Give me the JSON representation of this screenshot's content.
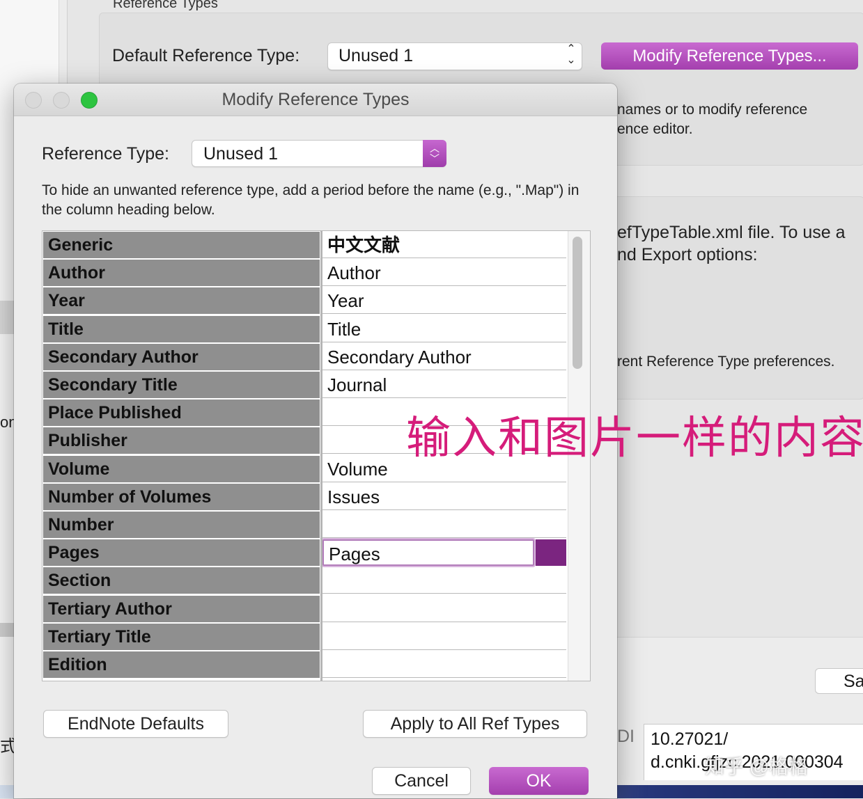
{
  "background": {
    "group_label": "Reference Types",
    "default_ref_type_label": "Default Reference Type:",
    "default_ref_type_value": "Unused 1",
    "modify_button": "Modify Reference Types...",
    "text1": "names or to modify reference",
    "text2": "ence editor.",
    "text3": "efTypeTable.xml file. To use a",
    "text4": "nd Export options:",
    "text5": "rent Reference Type preferences.",
    "left_fragment1": "on",
    "left_fragment2": "式及",
    "save_button": "Sa",
    "doi_label": "DI",
    "doi_value": "10.27021/\nd.cnki.gfjzc.2021.000304",
    "annotation": "输入和图片一样的内容",
    "watermark": "知乎 @格格"
  },
  "dialog": {
    "title": "Modify Reference Types",
    "ref_type_label": "Reference Type:",
    "ref_type_value": "Unused 1",
    "hint": "To hide an unwanted reference type, add a period before the name (e.g., \".Map\") in the column heading below.",
    "rows": [
      {
        "field": "Generic",
        "value": "中文文献"
      },
      {
        "field": "Author",
        "value": "Author"
      },
      {
        "field": "Year",
        "value": "Year"
      },
      {
        "field": "Title",
        "value": "Title"
      },
      {
        "field": "Secondary Author",
        "value": "Secondary Author"
      },
      {
        "field": "Secondary Title",
        "value": "Journal"
      },
      {
        "field": "Place Published",
        "value": ""
      },
      {
        "field": "Publisher",
        "value": ""
      },
      {
        "field": "Volume",
        "value": "Volume"
      },
      {
        "field": "Number of Volumes",
        "value": "Issues"
      },
      {
        "field": "Number",
        "value": ""
      },
      {
        "field": "Pages",
        "value": "Pages"
      },
      {
        "field": "Section",
        "value": ""
      },
      {
        "field": "Tertiary Author",
        "value": ""
      },
      {
        "field": "Tertiary Title",
        "value": ""
      },
      {
        "field": "Edition",
        "value": ""
      }
    ],
    "buttons": {
      "defaults": "EndNote Defaults",
      "apply_all": "Apply to All Ref Types",
      "cancel": "Cancel",
      "ok": "OK"
    }
  }
}
